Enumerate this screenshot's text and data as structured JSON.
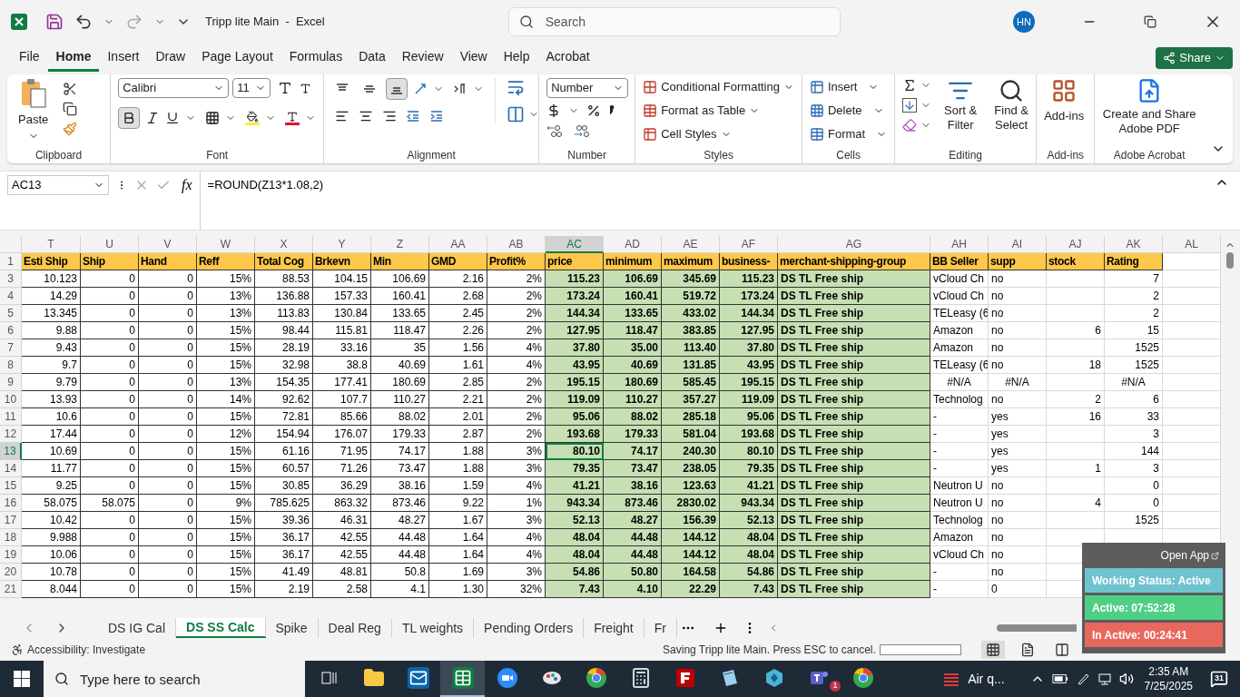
{
  "title_bar": {
    "title": "Tripp lite Main  -  Excel",
    "search": {
      "placeholder": "Search"
    },
    "avatar": "HN"
  },
  "menu": [
    {
      "label": "File",
      "selected": false
    },
    {
      "label": "Home",
      "selected": true
    },
    {
      "label": "Insert",
      "selected": false
    },
    {
      "label": "Draw",
      "selected": false
    },
    {
      "label": "Page Layout",
      "selected": false
    },
    {
      "label": "Formulas",
      "selected": false
    },
    {
      "label": "Data",
      "selected": false
    },
    {
      "label": "Review",
      "selected": false
    },
    {
      "label": "View",
      "selected": false
    },
    {
      "label": "Help",
      "selected": false
    },
    {
      "label": "Acrobat",
      "selected": false
    }
  ],
  "share": "Share",
  "ribbon": {
    "clipboard": {
      "paste": "Paste",
      "label": "Clipboard"
    },
    "font": {
      "name": "Calibri",
      "size": "11",
      "bold": true,
      "label": "Font"
    },
    "alignment": {
      "vertical": [
        {
          "selected": false
        },
        {
          "selected": false
        },
        {
          "selected": true
        }
      ],
      "label": "Alignment"
    },
    "number": {
      "format": "Number",
      "label": "Number"
    },
    "styles": {
      "items": [
        "Conditional Formatting",
        "Format as Table",
        "Cell Styles"
      ],
      "label": "Styles"
    },
    "cells": {
      "items": [
        "Insert",
        "Delete",
        "Format"
      ],
      "label": "Cells"
    },
    "editing": {
      "sort": "Sort & Filter",
      "find": "Find & Select",
      "label": "Editing"
    },
    "addins": {
      "button": "Add-ins",
      "label": "Add-ins"
    },
    "acrobat": {
      "button": "Create and Share Adobe PDF",
      "label": "Adobe Acrobat"
    }
  },
  "formula_bar": {
    "name_box": "AC13",
    "fx": "fx",
    "formula": "=ROUND(Z13*1.08,2)"
  },
  "sheet": {
    "header_row": "1",
    "columns": [
      {
        "letter": "T",
        "header": "Esti Ship",
        "kind": "number",
        "highlighted": false,
        "selected": false
      },
      {
        "letter": "U",
        "header": "Ship",
        "kind": "number",
        "highlighted": false,
        "selected": false
      },
      {
        "letter": "V",
        "header": "Hand",
        "kind": "number",
        "highlighted": false,
        "selected": false
      },
      {
        "letter": "W",
        "header": "Reff",
        "kind": "number",
        "highlighted": false,
        "selected": false
      },
      {
        "letter": "X",
        "header": "Total Cog",
        "kind": "number",
        "highlighted": false,
        "selected": false
      },
      {
        "letter": "Y",
        "header": "Brkevn",
        "kind": "number",
        "highlighted": false,
        "selected": false
      },
      {
        "letter": "Z",
        "header": "Min",
        "kind": "number",
        "highlighted": false,
        "selected": false
      },
      {
        "letter": "AA",
        "header": "GMD",
        "kind": "number",
        "highlighted": false,
        "selected": false
      },
      {
        "letter": "AB",
        "header": "Profit%",
        "kind": "number",
        "highlighted": false,
        "selected": false
      },
      {
        "letter": "AC",
        "header": "price",
        "kind": "number",
        "highlighted": true,
        "selected": true
      },
      {
        "letter": "AD",
        "header": "minimum",
        "kind": "number",
        "highlighted": true,
        "selected": false
      },
      {
        "letter": "AE",
        "header": "maximum",
        "kind": "number",
        "highlighted": true,
        "selected": false
      },
      {
        "letter": "AF",
        "header": "business-",
        "kind": "number",
        "highlighted": true,
        "selected": false
      },
      {
        "letter": "AG",
        "header": "merchant-shipping-group",
        "kind": "text",
        "highlighted": true,
        "selected": false
      },
      {
        "letter": "AH",
        "header": "BB Seller",
        "kind": "text",
        "highlighted": false,
        "selected": false
      },
      {
        "letter": "AI",
        "header": "supp",
        "kind": "text",
        "highlighted": false,
        "selected": false
      },
      {
        "letter": "AJ",
        "header": "stock",
        "kind": "number",
        "highlighted": false,
        "selected": false
      },
      {
        "letter": "AK",
        "header": "Rating",
        "kind": "number",
        "highlighted": false,
        "selected": false
      },
      {
        "letter": "AL",
        "selected": false
      }
    ],
    "rows": [
      {
        "number": "3",
        "selected": false,
        "cells": [
          "10.123",
          "0",
          "0",
          "15%",
          "88.53",
          "104.15",
          "106.69",
          "2.16",
          "2%",
          "115.23",
          "106.69",
          "345.69",
          "115.23",
          "DS TL Free ship",
          "vCloud Ch",
          "no",
          null,
          "7",
          null
        ]
      },
      {
        "number": "4",
        "selected": false,
        "cells": [
          "14.29",
          "0",
          "0",
          "13%",
          "136.88",
          "157.33",
          "160.41",
          "2.68",
          "2%",
          "173.24",
          "160.41",
          "519.72",
          "173.24",
          "DS TL Free ship",
          "vCloud Ch",
          "no",
          null,
          "2",
          null
        ]
      },
      {
        "number": "5",
        "selected": false,
        "cells": [
          "13.345",
          "0",
          "0",
          "13%",
          "113.83",
          "130.84",
          "133.65",
          "2.45",
          "2%",
          "144.34",
          "133.65",
          "433.02",
          "144.34",
          "DS TL Free ship",
          "TELeasy (6",
          "no",
          null,
          "2",
          null
        ]
      },
      {
        "number": "6",
        "selected": false,
        "cells": [
          "9.88",
          "0",
          "0",
          "15%",
          "98.44",
          "115.81",
          "118.47",
          "2.26",
          "2%",
          "127.95",
          "118.47",
          "383.85",
          "127.95",
          "DS TL Free ship",
          "Amazon",
          "no",
          "6",
          "15",
          null
        ]
      },
      {
        "number": "7",
        "selected": false,
        "cells": [
          "9.43",
          "0",
          "0",
          "15%",
          "28.19",
          "33.16",
          "35",
          "1.56",
          "4%",
          "37.80",
          "35.00",
          "113.40",
          "37.80",
          "DS TL Free ship",
          "Amazon",
          "no",
          null,
          "1525",
          null
        ]
      },
      {
        "number": "8",
        "selected": false,
        "cells": [
          "9.7",
          "0",
          "0",
          "15%",
          "32.98",
          "38.8",
          "40.69",
          "1.61",
          "4%",
          "43.95",
          "40.69",
          "131.85",
          "43.95",
          "DS TL Free ship",
          "TELeasy (6",
          "no",
          "18",
          "1525",
          null
        ]
      },
      {
        "number": "9",
        "selected": false,
        "cells": [
          "9.79",
          "0",
          "0",
          "13%",
          "154.35",
          "177.41",
          "180.69",
          "2.85",
          "2%",
          "195.15",
          "180.69",
          "585.45",
          "195.15",
          "DS TL Free ship",
          {
            "text": "#N/A",
            "kind": "error"
          },
          {
            "text": "#N/A",
            "kind": "error"
          },
          null,
          {
            "text": "#N/A",
            "kind": "error"
          },
          null
        ]
      },
      {
        "number": "10",
        "selected": false,
        "cells": [
          "13.93",
          "0",
          "0",
          "14%",
          "92.62",
          "107.7",
          "110.27",
          "2.21",
          "2%",
          "119.09",
          "110.27",
          "357.27",
          "119.09",
          "DS TL Free ship",
          "Technolog",
          "no",
          "2",
          "6",
          null
        ]
      },
      {
        "number": "11",
        "selected": false,
        "cells": [
          "10.6",
          "0",
          "0",
          "15%",
          "72.81",
          "85.66",
          "88.02",
          "2.01",
          "2%",
          "95.06",
          "88.02",
          "285.18",
          "95.06",
          "DS TL Free ship",
          "-",
          "yes",
          "16",
          "33",
          null
        ]
      },
      {
        "number": "12",
        "selected": false,
        "cells": [
          "17.44",
          "0",
          "0",
          "12%",
          "154.94",
          "176.07",
          "179.33",
          "2.87",
          "2%",
          "193.68",
          "179.33",
          "581.04",
          "193.68",
          "DS TL Free ship",
          "-",
          "yes",
          null,
          "3",
          null
        ]
      },
      {
        "number": "13",
        "selected": true,
        "cells": [
          "10.69",
          "0",
          "0",
          "15%",
          "61.16",
          "71.95",
          "74.17",
          "1.88",
          "3%",
          "80.10",
          "74.17",
          "240.30",
          "80.10",
          "DS TL Free ship",
          "-",
          "yes",
          null,
          "144",
          null
        ]
      },
      {
        "number": "14",
        "selected": false,
        "cells": [
          "11.77",
          "0",
          "0",
          "15%",
          "60.57",
          "71.26",
          "73.47",
          "1.88",
          "3%",
          "79.35",
          "73.47",
          "238.05",
          "79.35",
          "DS TL Free ship",
          "-",
          "yes",
          "1",
          "3",
          null
        ]
      },
      {
        "number": "15",
        "selected": false,
        "cells": [
          "9.25",
          "0",
          "0",
          "15%",
          "30.85",
          "36.29",
          "38.16",
          "1.59",
          "4%",
          "41.21",
          "38.16",
          "123.63",
          "41.21",
          "DS TL Free ship",
          "Neutron U",
          "no",
          null,
          "0",
          null
        ]
      },
      {
        "number": "16",
        "selected": false,
        "cells": [
          "58.075",
          "58.075",
          "0",
          "9%",
          "785.625",
          "863.32",
          "873.46",
          "9.22",
          "1%",
          "943.34",
          "873.46",
          "2830.02",
          "943.34",
          "DS TL Free ship",
          "Neutron U",
          "no",
          "4",
          "0",
          null
        ]
      },
      {
        "number": "17",
        "selected": false,
        "cells": [
          "10.42",
          "0",
          "0",
          "15%",
          "39.36",
          "46.31",
          "48.27",
          "1.67",
          "3%",
          "52.13",
          "48.27",
          "156.39",
          "52.13",
          "DS TL Free ship",
          "Technolog",
          "no",
          null,
          "1525",
          null
        ]
      },
      {
        "number": "18",
        "selected": false,
        "cells": [
          "9.988",
          "0",
          "0",
          "15%",
          "36.17",
          "42.55",
          "44.48",
          "1.64",
          "4%",
          "48.04",
          "44.48",
          "144.12",
          "48.04",
          "DS TL Free ship",
          "Amazon",
          "no",
          null,
          null,
          null
        ]
      },
      {
        "number": "19",
        "selected": false,
        "cells": [
          "10.06",
          "0",
          "0",
          "15%",
          "36.17",
          "42.55",
          "44.48",
          "1.64",
          "4%",
          "48.04",
          "44.48",
          "144.12",
          "48.04",
          "DS TL Free ship",
          "vCloud Ch",
          "no",
          null
        ]
      },
      {
        "number": "20",
        "selected": false,
        "cells": [
          "10.78",
          "0",
          "0",
          "15%",
          "41.49",
          "48.81",
          "50.8",
          "1.69",
          "3%",
          "54.86",
          "50.80",
          "164.58",
          "54.86",
          "DS TL Free ship",
          "-",
          "no",
          null
        ]
      },
      {
        "number": "21",
        "selected": false,
        "cells": [
          "8.044",
          "0",
          "0",
          "15%",
          "2.19",
          "2.58",
          "4.1",
          "1.30",
          "32%",
          "7.43",
          "4.10",
          "22.29",
          "7.43",
          "DS TL Free ship",
          "-",
          "0",
          null
        ]
      }
    ]
  },
  "sheet_tabs": [
    {
      "label": "DS IG Cal",
      "selected": false
    },
    {
      "label": "DS SS Calc",
      "selected": true
    },
    {
      "label": "Spike",
      "selected": false
    },
    {
      "label": "Deal Reg",
      "selected": false
    },
    {
      "label": "TL weights",
      "selected": false
    },
    {
      "label": "Pending Orders",
      "selected": false
    },
    {
      "label": "Freight",
      "selected": false
    },
    {
      "label": "Fr",
      "selected": false
    }
  ],
  "status_bar": {
    "accessibility": "Accessibility: Investigate",
    "message": "Saving Tripp lite Main. Press ESC to cancel.",
    "progress": {
      "level": 0
    },
    "views": [
      {
        "selected": true
      },
      {
        "selected": false
      },
      {
        "selected": false
      }
    ]
  },
  "tracker": {
    "open_app": "Open App",
    "status": "Working Status: Active",
    "active": "Active: 07:52:28",
    "inactive": "In Active: 00:24:41"
  },
  "taskbar": {
    "search": {
      "placeholder": "Type here to search"
    },
    "apps": [
      {
        "kind": "taskview",
        "selected": false
      },
      {
        "kind": "explorer",
        "selected": false
      },
      {
        "kind": "outlook",
        "selected": false
      },
      {
        "kind": "excel",
        "selected": true
      },
      {
        "kind": "zoom",
        "selected": false
      },
      {
        "kind": "paint",
        "selected": false
      },
      {
        "kind": "chrome",
        "selected": false
      },
      {
        "kind": "calculator",
        "selected": false
      },
      {
        "kind": "filezilla",
        "selected": false
      },
      {
        "kind": "notepad",
        "selected": false
      },
      {
        "kind": "cube",
        "selected": false
      },
      {
        "kind": "teams",
        "selected": false,
        "badge": "1"
      },
      {
        "kind": "chrome",
        "selected": false
      }
    ],
    "weather": "Air q...",
    "time": "2:35 AM",
    "date": "7/25/2025",
    "notifications": "31"
  }
}
